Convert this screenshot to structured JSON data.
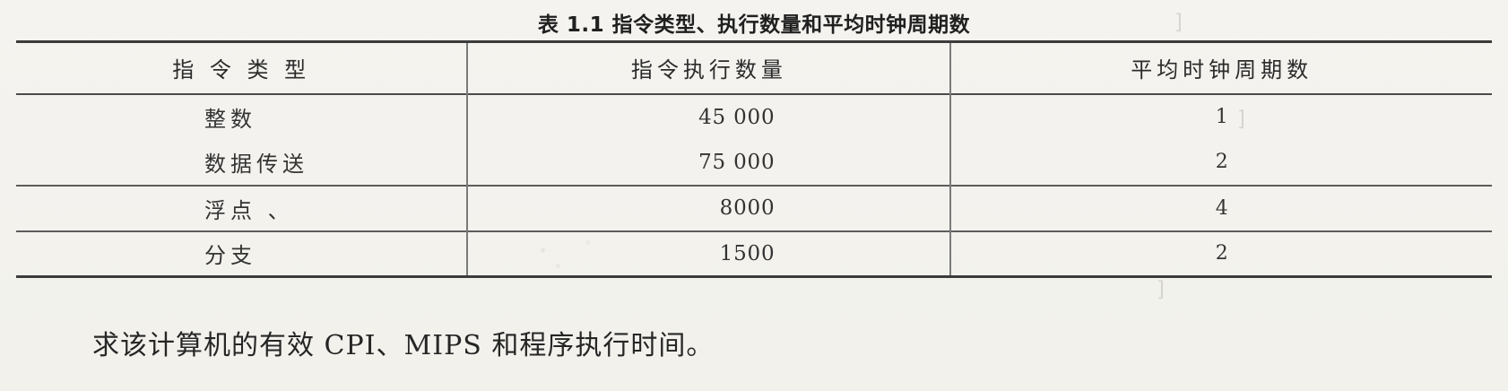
{
  "title": "表 1.1  指令类型、执行数量和平均时钟周期数",
  "table": {
    "headers": [
      "指 令 类 型",
      "指令执行数量",
      "平均时钟周期数"
    ],
    "rows": [
      {
        "type": "整数",
        "count": "45 000",
        "cpi": "1"
      },
      {
        "type": "数据传送",
        "count": "75 000",
        "cpi": "2"
      },
      {
        "type": "浮点 、",
        "count": "8000",
        "cpi": "4"
      },
      {
        "type": "分支",
        "count": "1500",
        "cpi": "2"
      }
    ]
  },
  "question": "求该计算机的有效 CPI、MIPS 和程序执行时间。"
}
